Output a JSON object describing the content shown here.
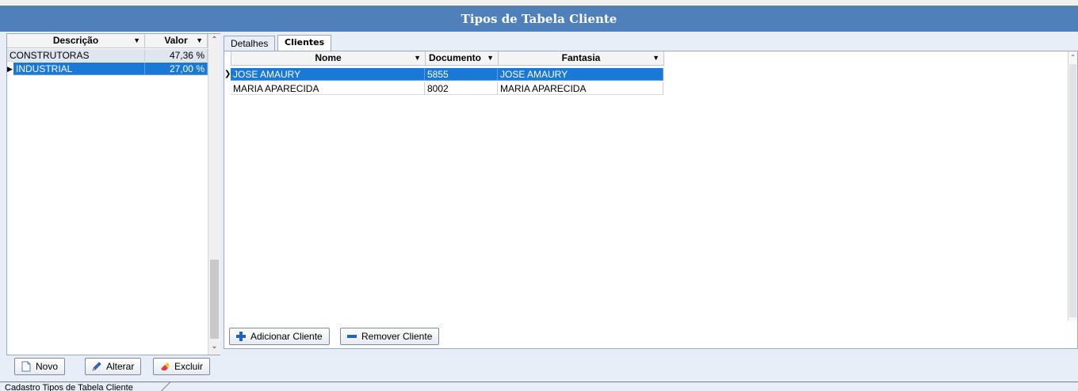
{
  "window": {
    "title": "Tipos de Tabela Cliente"
  },
  "left_grid": {
    "columns": [
      "Descrição",
      "Valor"
    ],
    "rows": [
      {
        "descricao": "CONSTRUTORAS",
        "valor": "47,36 %"
      },
      {
        "descricao": "INDUSTRIAL",
        "valor": "27,00 %"
      }
    ],
    "selected_row": 1
  },
  "tabs": [
    {
      "label": "Detalhes"
    },
    {
      "label": "Clientes"
    }
  ],
  "active_tab": "Clientes",
  "clients_grid": {
    "columns": [
      "Nome",
      "Documento",
      "Fantasia"
    ],
    "rows": [
      {
        "nome": "JOSE AMAURY",
        "documento": "5855",
        "fantasia": "JOSE AMAURY"
      },
      {
        "nome": "MARIA APARECIDA",
        "documento": "8002",
        "fantasia": "MARIA APARECIDA"
      }
    ],
    "selected_row": 0
  },
  "client_buttons": {
    "add": "Adicionar Cliente",
    "remove": "Remover Cliente"
  },
  "footer_buttons": {
    "new": "Novo",
    "edit": "Alterar",
    "delete": "Excluir"
  },
  "status": {
    "tab_label": "Cadastro Tipos de Tabela Cliente"
  },
  "colors": {
    "title_bar": "#4f80b9",
    "selection": "#1a78d6",
    "background": "#e8eef7"
  }
}
